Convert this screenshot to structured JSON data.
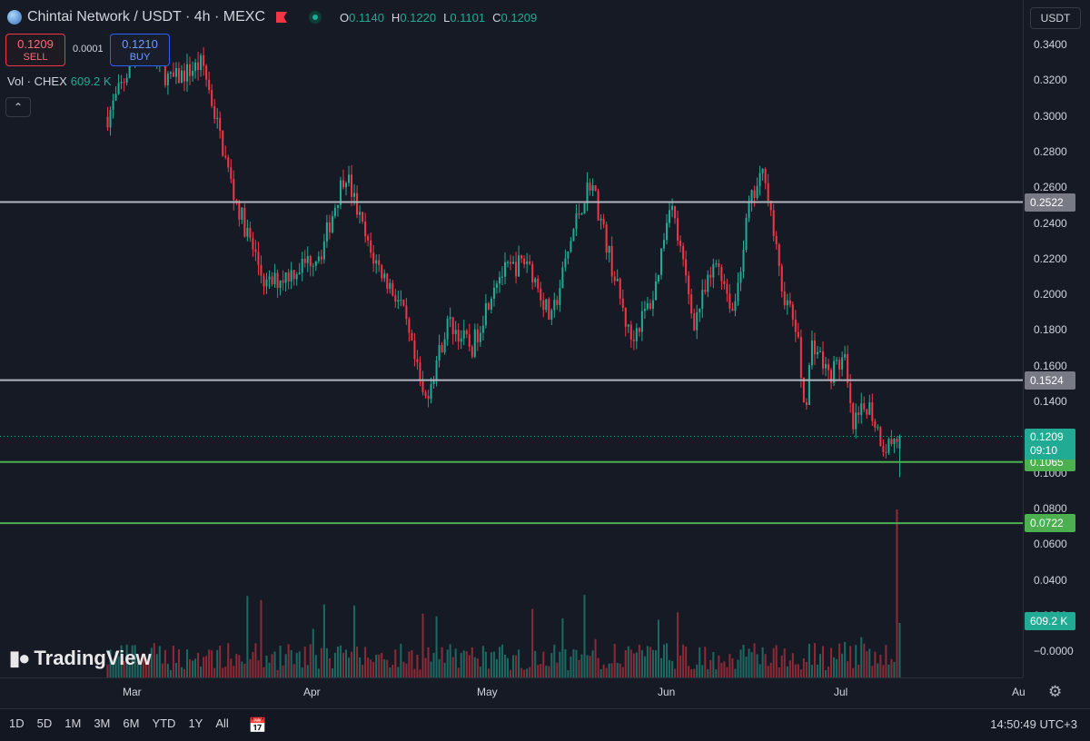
{
  "legend": {
    "title": "Chintai Network / USDT · 4h · MEXC",
    "ohlc": [
      {
        "k": "O",
        "v": "0.1140"
      },
      {
        "k": "H",
        "v": "0.1220"
      },
      {
        "k": "L",
        "v": "0.1101"
      },
      {
        "k": "C",
        "v": "0.1209"
      }
    ]
  },
  "trade": {
    "sell_price": "0.1209",
    "sell_label": "SELL",
    "buy_price": "0.1210",
    "buy_label": "BUY",
    "spread": "0.0001"
  },
  "volume_legend": {
    "label": "Vol · CHEX",
    "value": "609.2 K"
  },
  "collapse_icon": "chevron-up-icon",
  "currency": "USDT",
  "brand": "TradingView",
  "price_ticks": [
    "0.3400",
    "0.3200",
    "0.3000",
    "0.2800",
    "0.2600",
    "0.2400",
    "0.2200",
    "0.2000",
    "0.1800",
    "0.1600",
    "0.1400",
    "0.1200",
    "0.1000",
    "0.0800",
    "0.0600",
    "0.0400",
    "0.0200",
    "−0.0000"
  ],
  "levels": [
    {
      "value": 0.2522,
      "label": "0.2522",
      "color": "#b2b5be",
      "kind": "gray"
    },
    {
      "value": 0.1524,
      "label": "0.1524",
      "color": "#b2b5be",
      "kind": "gray"
    },
    {
      "value": 0.1065,
      "label": "0.1065",
      "color": "#4caf50",
      "kind": "green"
    },
    {
      "value": 0.0722,
      "label": "0.0722",
      "color": "#4caf50",
      "kind": "green"
    }
  ],
  "current": {
    "price": "0.1209",
    "countdown": "09:10"
  },
  "volume_label": "609.2 K",
  "months": [
    "Mar",
    "Apr",
    "May",
    "Jun",
    "Jul",
    "Au"
  ],
  "bottom": {
    "ranges": [
      "1D",
      "5D",
      "1M",
      "3M",
      "6M",
      "YTD",
      "1Y",
      "All"
    ],
    "clock": "14:50:49 UTC+3"
  },
  "colors": {
    "up": "#22ab94",
    "down": "#f23645",
    "bg": "#161a25"
  },
  "chart_data": {
    "type": "candlestick",
    "title": "Chintai Network / USDT · 4h · MEXC",
    "ylim": [
      0.0,
      0.35
    ],
    "x_labels": [
      "Mar",
      "Apr",
      "May",
      "Jun",
      "Jul"
    ],
    "trend_points": [
      {
        "t": 0.0,
        "p": 0.3
      },
      {
        "t": 0.04,
        "p": 0.34
      },
      {
        "t": 0.08,
        "p": 0.32
      },
      {
        "t": 0.12,
        "p": 0.33
      },
      {
        "t": 0.16,
        "p": 0.255
      },
      {
        "t": 0.2,
        "p": 0.205
      },
      {
        "t": 0.24,
        "p": 0.215
      },
      {
        "t": 0.27,
        "p": 0.225
      },
      {
        "t": 0.3,
        "p": 0.27
      },
      {
        "t": 0.33,
        "p": 0.225
      },
      {
        "t": 0.37,
        "p": 0.195
      },
      {
        "t": 0.4,
        "p": 0.14
      },
      {
        "t": 0.43,
        "p": 0.185
      },
      {
        "t": 0.46,
        "p": 0.17
      },
      {
        "t": 0.49,
        "p": 0.21
      },
      {
        "t": 0.53,
        "p": 0.22
      },
      {
        "t": 0.56,
        "p": 0.185
      },
      {
        "t": 0.59,
        "p": 0.24
      },
      {
        "t": 0.61,
        "p": 0.265
      },
      {
        "t": 0.64,
        "p": 0.21
      },
      {
        "t": 0.66,
        "p": 0.175
      },
      {
        "t": 0.69,
        "p": 0.2
      },
      {
        "t": 0.71,
        "p": 0.255
      },
      {
        "t": 0.74,
        "p": 0.185
      },
      {
        "t": 0.77,
        "p": 0.22
      },
      {
        "t": 0.79,
        "p": 0.19
      },
      {
        "t": 0.81,
        "p": 0.25
      },
      {
        "t": 0.83,
        "p": 0.27
      },
      {
        "t": 0.85,
        "p": 0.205
      },
      {
        "t": 0.87,
        "p": 0.18
      },
      {
        "t": 0.88,
        "p": 0.135
      },
      {
        "t": 0.89,
        "p": 0.175
      },
      {
        "t": 0.91,
        "p": 0.155
      },
      {
        "t": 0.93,
        "p": 0.165
      },
      {
        "t": 0.94,
        "p": 0.125
      },
      {
        "t": 0.96,
        "p": 0.14
      },
      {
        "t": 0.98,
        "p": 0.115
      },
      {
        "t": 1.0,
        "p": 0.1209
      }
    ],
    "last_close": 0.1209,
    "last_low": 0.098,
    "volume_last": 609200,
    "horizontal_levels": [
      0.2522,
      0.1524,
      0.1065,
      0.0722
    ]
  }
}
